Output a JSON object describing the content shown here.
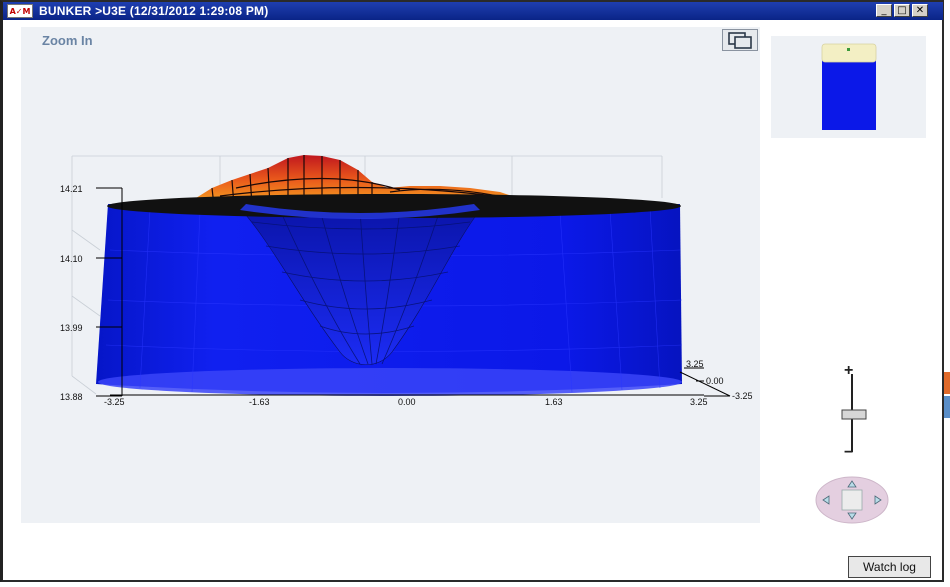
{
  "window": {
    "app_icon_text": "A✓M",
    "title": "BUNKER >U3E (12/31/2012 1:29:08 PM)",
    "minimize_glyph": "_",
    "maximize_glyph": "□",
    "close_glyph": "✕"
  },
  "plot": {
    "zoom_label": "Zoom In",
    "vertical_ticks": [
      "14.21",
      "14.10",
      "13.99",
      "13.88"
    ],
    "horizontal_ticks": [
      "-3.25",
      "-1.63",
      "0.00",
      "1.63",
      "3.25"
    ],
    "depth_ticks": [
      "3.25",
      "0.00",
      "-3.25"
    ],
    "colors": {
      "cylinder": "#0b18e8",
      "surface_high": "#c0171e",
      "surface_mid": "#f4a21a",
      "top_rim": "#111111",
      "panel_bg": "#eef1f5"
    }
  },
  "controls": {
    "zoom_plus": "+",
    "zoom_minus": "−",
    "watch_log_label": "Watch log",
    "icons": [
      "copy-window-icon",
      "zoom-slider-icon",
      "pan-up-icon",
      "pan-down-icon",
      "pan-left-icon",
      "pan-right-icon"
    ]
  }
}
